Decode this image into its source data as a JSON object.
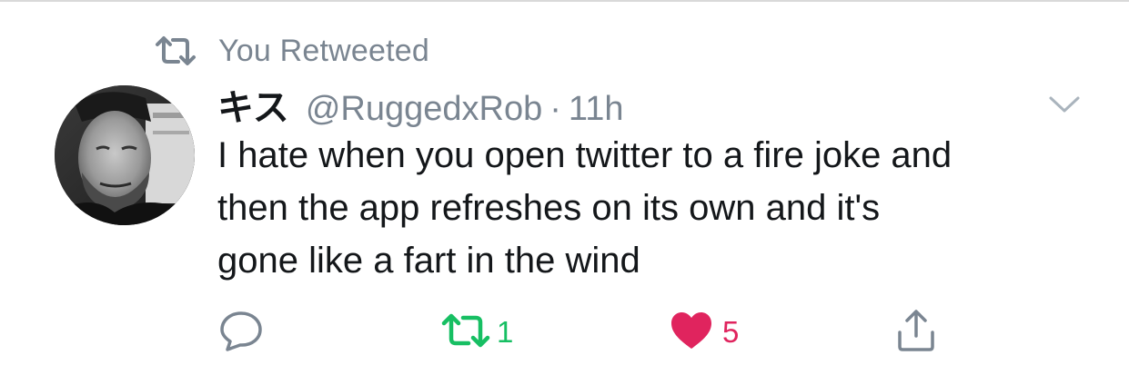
{
  "retweet_context": {
    "icon": "retweet-icon",
    "label": "You Retweeted"
  },
  "author": {
    "display_name": "キス",
    "handle": "@RuggedxRob",
    "separator": "·",
    "time": "11h"
  },
  "tweet": {
    "lines": [
      "I hate when you open twitter to a fire joke and",
      "then the app refreshes on its own and it's",
      "gone like a fart in the wind"
    ]
  },
  "actions": {
    "reply": {
      "icon": "reply-icon"
    },
    "retweet": {
      "icon": "retweet-icon",
      "count": "1",
      "color": "#17bf63"
    },
    "like": {
      "icon": "heart-icon",
      "count": "5",
      "color": "#e0245e"
    },
    "share": {
      "icon": "share-icon"
    }
  },
  "colors": {
    "text": "#14171a",
    "secondary": "#7a8591",
    "retweet_green": "#17bf63",
    "like_red": "#e0245e"
  }
}
